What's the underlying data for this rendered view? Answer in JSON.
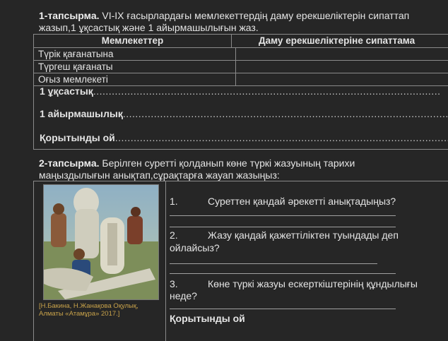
{
  "task1": {
    "label": "1-тапсырма.",
    "text_line1": " VI-IX ғасырлардағы мемлекеттердің даму ерекшеліктерін сипаттап",
    "text_line2": "жазып,1 ұқсастық және 1 айырмашылығын  жаз."
  },
  "table": {
    "headers": [
      "Мемлекеттер",
      "Даму ерекшеліктеріне сипаттама"
    ],
    "rows": [
      [
        "Түрік қағанатына",
        ""
      ],
      [
        "Түргеш қағанаты",
        ""
      ],
      [
        "Оғыз мемлекеті",
        ""
      ]
    ]
  },
  "fill_lines": {
    "similarity": "1 ұқсастық",
    "similarity_dots": "................................................................................................................",
    "difference": "1 айырмашылық",
    "difference_dots": "..........................................................................................................",
    "conclusion": "Қорытынды ой",
    "conclusion_dots": "............................................................................................................"
  },
  "task2": {
    "label": "2-тапсырма.",
    "text_line1": " Берілген суретті қолданып көне түркі жазуының тарихи",
    "text_line2": "маңыздылығын анықтап,сұрақтарға жауап жазыңыз:"
  },
  "image": {
    "caption_line1": "[Н.Бакина, Н.Жанақова Оқулық,",
    "caption_line2": "Алматы «Атамұра» 2017.]"
  },
  "questions": {
    "q1_num": "1.",
    "q1_text": "Суреттен қандай әрекетті анықтадыңыз?",
    "q2_num": "2.",
    "q2_text": "Жазу қандай қажеттіліктен туындады деп",
    "q2_text2": "ойлайсыз?",
    "q3_num": "3.",
    "q3_text": "Көне түркі жазуы ескерткіштерінің құндылығы",
    "q3_text2": "неде?",
    "conclusion": "Қорытынды ой"
  }
}
